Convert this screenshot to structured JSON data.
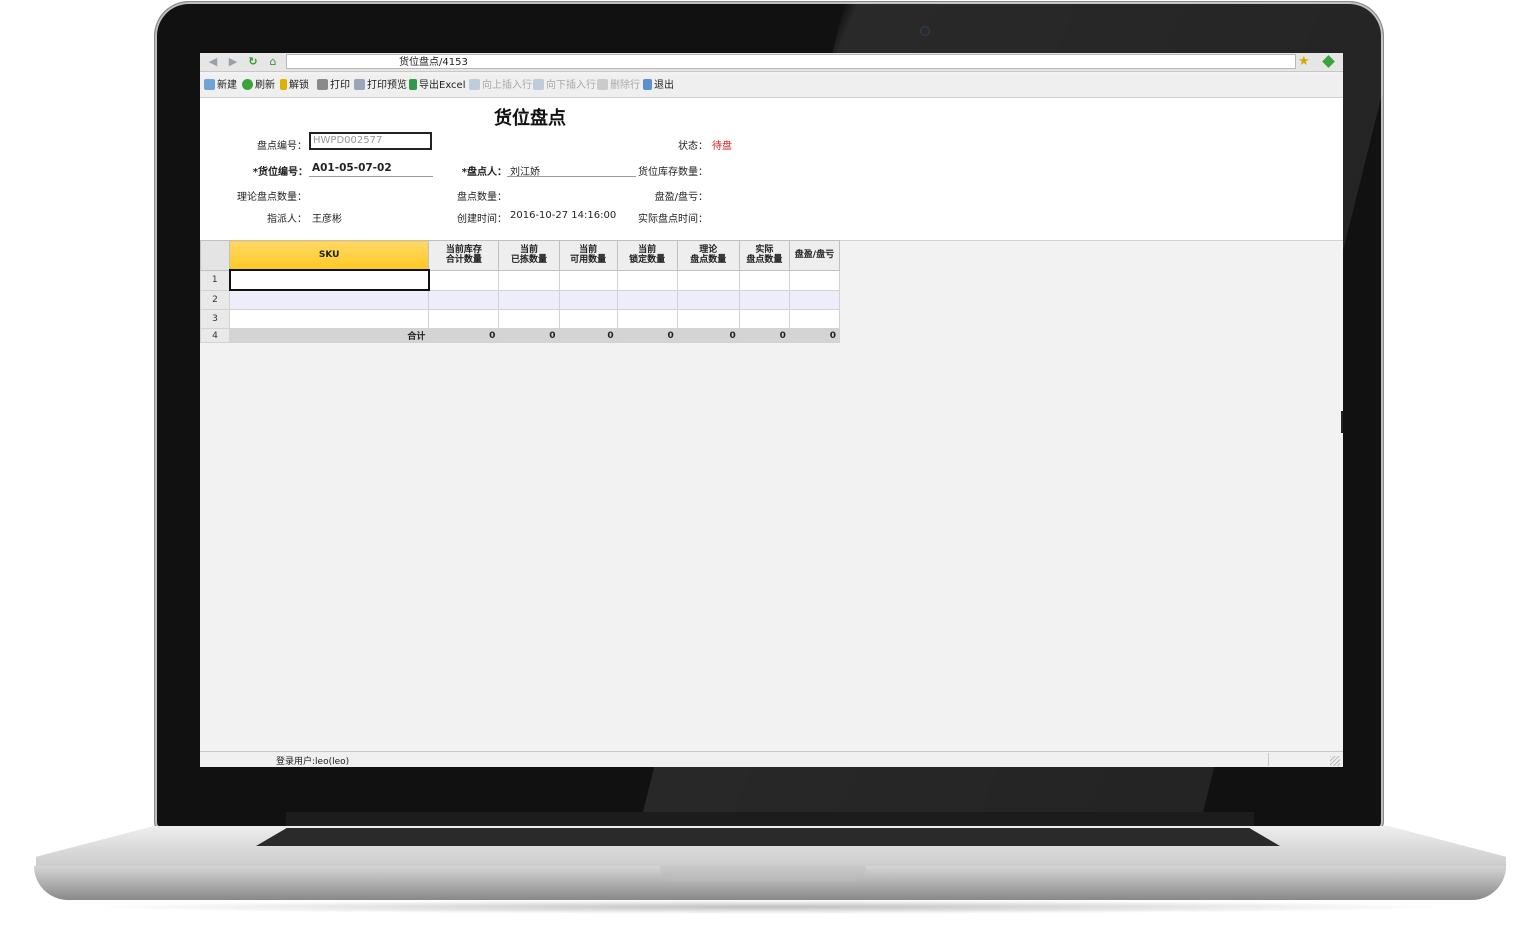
{
  "browser": {
    "address": "货位盘点/4153"
  },
  "toolbar": {
    "buttons": [
      {
        "label": "新建",
        "icon": "new-icon",
        "enabled": true
      },
      {
        "label": "刷新",
        "icon": "refresh-icon",
        "enabled": true
      },
      {
        "label": "解锁",
        "icon": "unlock-icon",
        "enabled": true
      },
      {
        "label": "打印",
        "icon": "print-icon",
        "enabled": true
      },
      {
        "label": "打印预览",
        "icon": "print-preview-icon",
        "enabled": true
      },
      {
        "label": "导出Excel",
        "icon": "excel-icon",
        "enabled": true
      },
      {
        "label": "向上插入行",
        "icon": "insert-above-icon",
        "enabled": false
      },
      {
        "label": "向下插入行",
        "icon": "insert-below-icon",
        "enabled": false
      },
      {
        "label": "删除行",
        "icon": "delete-row-icon",
        "enabled": false
      },
      {
        "label": "退出",
        "icon": "exit-icon",
        "enabled": true
      }
    ]
  },
  "form": {
    "title": "货位盘点",
    "count_no_label": "盘点编号：",
    "count_no_value": "HWPD002577",
    "status_label": "状态：",
    "status_value": "待盘",
    "location_no_label": "*货位编号：",
    "location_no_value": "A01-05-07-02",
    "counter_label": "*盘点人：",
    "counter_value": "刘江娇",
    "location_stock_label": "货位库存数量：",
    "theory_qty_label": "理论盘点数量：",
    "count_qty_label": "盘点数量：",
    "profit_loss_label": "盘盈/盘亏：",
    "assigner_label": "指派人：",
    "assigner_value": "王彦彬",
    "created_label": "创建时间：",
    "created_value": "2016-10-27 14:16:00",
    "actual_time_label": "实际盘点时间："
  },
  "grid": {
    "columns": [
      {
        "line1": "SKU",
        "line2": ""
      },
      {
        "line1": "当前库存",
        "line2": "合计数量"
      },
      {
        "line1": "当前",
        "line2": "已拣数量"
      },
      {
        "line1": "当前",
        "line2": "可用数量"
      },
      {
        "line1": "当前",
        "line2": "锁定数量"
      },
      {
        "line1": "理论",
        "line2": "盘点数量"
      },
      {
        "line1": "实际",
        "line2": "盘点数量"
      },
      {
        "line1": "盘盈/盘亏",
        "line2": ""
      }
    ],
    "row_numbers": [
      "1",
      "2",
      "3",
      "4"
    ],
    "total": {
      "label": "合计",
      "values": [
        "0",
        "0",
        "0",
        "0",
        "0",
        "0",
        "0"
      ]
    }
  },
  "status_bar": {
    "user": "登录用户:leo(leo)"
  }
}
